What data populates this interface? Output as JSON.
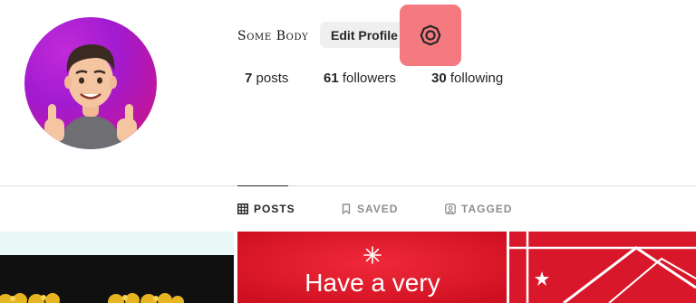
{
  "profile": {
    "username": "Some Body",
    "edit_profile_label": "Edit Profile",
    "settings_icon": "settings-icon"
  },
  "stats": {
    "posts_count": "7",
    "posts_label": "posts",
    "followers_count": "61",
    "followers_label": "followers",
    "following_count": "30",
    "following_label": "following"
  },
  "tabs": [
    {
      "label": "POSTS",
      "icon": "grid-icon",
      "active": true
    },
    {
      "label": "SAVED",
      "icon": "bookmark-icon",
      "active": false
    },
    {
      "label": "TAGGED",
      "icon": "tagged-icon",
      "active": false
    }
  ],
  "posts": [
    {
      "text": ""
    },
    {
      "text": "Have a very"
    },
    {
      "text": ""
    }
  ],
  "colors": {
    "highlight": "#f47a80",
    "button_bg": "#efefef",
    "post_red": "#e2192c"
  }
}
